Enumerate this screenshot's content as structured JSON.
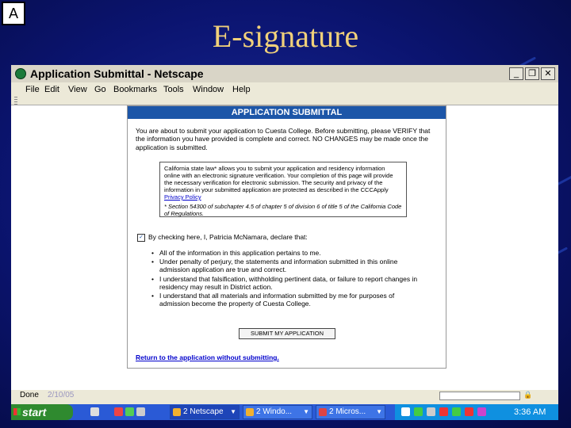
{
  "slide": {
    "badge": "A",
    "title": "E-signature"
  },
  "window": {
    "title": "Application Submittal - Netscape",
    "menu": [
      "File",
      "Edit",
      "View",
      "Go",
      "Bookmarks",
      "Tools",
      "Window",
      "Help"
    ]
  },
  "page": {
    "header": "APPLICATION SUBMITTAL",
    "intro": "You are about to submit your application to Cuesta College. Before submitting, please VERIFY that the information you have provided is complete and correct. NO CHANGES may be made once the application is submitted.",
    "law_text": "California state law* allows you to submit your application and residency information online with an electronic signature verification. Your completion of this page will provide the necessary verification for electronic submission. The security and privacy of the information in your submitted application are protected as described in the CCCApply",
    "law_link": "Privacy Policy",
    "law_footnote": "* Section 54300 of subchapter 4.5 of chapter 5 of division 6 of title 5 of the California Code of Regulations.",
    "check_label": "By checking here, I, Patricia McNamara, declare that:",
    "bullets": [
      "All of the information in this application pertains to me.",
      "Under penalty of perjury, the statements and information submitted in this online admission application are true and correct.",
      "I understand that falsification, withholding pertinent data, or failure to report changes in residency may result in District action.",
      "I understand that all materials and information submitted by me for purposes of admission become the property of Cuesta College."
    ],
    "submit_label": "SUBMIT MY APPLICATION",
    "return_link": "Return to the application without submitting."
  },
  "status": {
    "text": "Done",
    "date": "2/10/05"
  },
  "taskbar": {
    "start": "start",
    "tasks": [
      {
        "label": "Netscape",
        "count": "2"
      },
      {
        "label": "Windo...",
        "count": "2"
      },
      {
        "label": "Micros...",
        "count": "2"
      }
    ],
    "clock": "3:36 AM"
  }
}
